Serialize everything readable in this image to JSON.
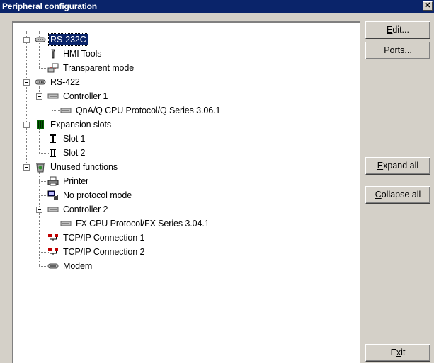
{
  "window": {
    "title": "Peripheral configuration",
    "close_glyph": "✕"
  },
  "tree": [
    {
      "label": "RS-232C",
      "icon": "serial-port-icon",
      "selected": true
    },
    {
      "label": "HMI Tools",
      "icon": "tool-icon"
    },
    {
      "label": "Transparent mode",
      "icon": "transparent-mode-icon"
    },
    {
      "label": "RS-422",
      "icon": "serial-port-icon"
    },
    {
      "label": "Controller 1",
      "icon": "controller-icon"
    },
    {
      "label": "QnA/Q CPU Protocol/Q Series 3.06.1",
      "icon": "protocol-icon"
    },
    {
      "label": "Expansion slots",
      "icon": "expansion-slots-icon"
    },
    {
      "label": "Slot 1",
      "icon": "slot-icon"
    },
    {
      "label": "Slot 2",
      "icon": "slot-icon"
    },
    {
      "label": "Unused functions",
      "icon": "unused-functions-icon"
    },
    {
      "label": "Printer",
      "icon": "printer-icon"
    },
    {
      "label": "No protocol mode",
      "icon": "no-protocol-icon"
    },
    {
      "label": "Controller 2",
      "icon": "controller-icon"
    },
    {
      "label": "FX CPU Protocol/FX Series 3.04.1",
      "icon": "protocol-icon"
    },
    {
      "label": "TCP/IP Connection 1",
      "icon": "network-icon"
    },
    {
      "label": "TCP/IP Connection 2",
      "icon": "network-icon"
    },
    {
      "label": "Modem",
      "icon": "modem-icon"
    }
  ],
  "buttons": {
    "edit": {
      "accel": "E",
      "rest": "dit..."
    },
    "ports": {
      "accel": "P",
      "rest": "orts..."
    },
    "expand_all": {
      "accel": "E",
      "rest": "xpand all"
    },
    "collapse_all": {
      "accel": "C",
      "rest": "ollapse all"
    },
    "exit": {
      "pre": "E",
      "accel": "x",
      "rest": "it"
    }
  },
  "colors": {
    "selection": "#0a246a",
    "face": "#d4d0c8"
  }
}
